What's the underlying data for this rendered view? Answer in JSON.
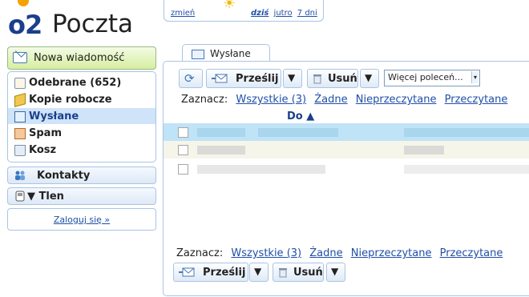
{
  "logo": {
    "brand": "o2",
    "product": "Poczta"
  },
  "weather": {
    "change_link": "zmień",
    "today": "dziś",
    "tomorrow": "jutro",
    "days7": "7 dni"
  },
  "sidebar": {
    "new_message": "Nowa wiadomość",
    "folders": [
      {
        "label": "Odebrane (652)",
        "icon": "inbox-icon"
      },
      {
        "label": "Kopie robocze",
        "icon": "drafts-icon"
      },
      {
        "label": "Wysłane",
        "icon": "sent-icon",
        "selected": true
      },
      {
        "label": "Spam",
        "icon": "spam-icon"
      },
      {
        "label": "Kosz",
        "icon": "trash-icon"
      }
    ],
    "contacts": "Kontakty",
    "tlen": "▼ Tlen",
    "login": "Zaloguj się »"
  },
  "main": {
    "tab": "Wysłane",
    "toolbar": {
      "forward": "Prześlij",
      "delete": "Usuń",
      "more_actions": "Więcej poleceń..."
    },
    "select": {
      "label": "Zaznacz:",
      "all": "Wszystkie (3)",
      "none": "Żadne",
      "unread": "Nieprzeczytane",
      "read": "Przeczytane"
    },
    "column": "Do ▲"
  },
  "colors": {
    "accent": "#1a3f8c",
    "link": "#1f4fa8",
    "selected_row": "#bfe3f7"
  }
}
